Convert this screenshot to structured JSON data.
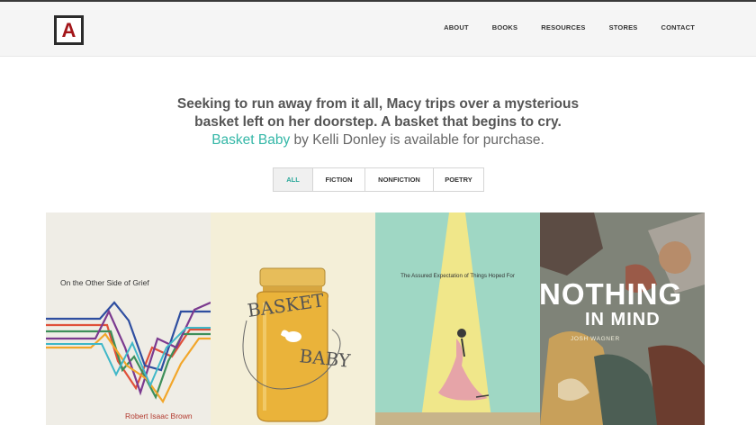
{
  "header": {
    "logo_letter": "A",
    "nav": [
      "ABOUT",
      "BOOKS",
      "RESOURCES",
      "STORES",
      "CONTACT"
    ]
  },
  "intro": {
    "line1": "Seeking to run away from it all, Macy trips over a mysterious",
    "line2": "basket left on her doorstep. A basket that begins to cry.",
    "book_link": "Basket Baby",
    "line3_rest": " by Kelli Donley is available for purchase."
  },
  "filters": [
    "ALL",
    "FICTION",
    "NONFICTION",
    "POETRY"
  ],
  "books": [
    {
      "title": "On the Other Side of Grief",
      "author": "Robert Isaac Brown"
    },
    {
      "title_line1": "BASKET",
      "title_line2": "BABY"
    },
    {
      "title": "The Assured Expectation of Things Hoped For"
    },
    {
      "title_line1": "NOTHING",
      "title_line2": "IN MIND",
      "author": "JOSH WAGNER"
    }
  ],
  "colors": {
    "accent": "#34b7a7",
    "logo_red": "#a3161a"
  }
}
